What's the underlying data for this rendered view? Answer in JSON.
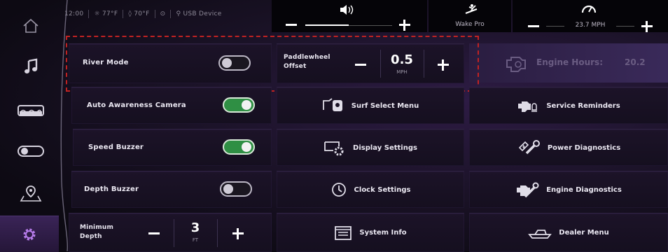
{
  "status_bar": {
    "time": "12:00",
    "outside_temp": "77°F",
    "water_temp": "70°F",
    "usb": "USB Device"
  },
  "top_controls": {
    "volume": {
      "level": 0.4
    },
    "wake_mode": "Wake Pro",
    "speed": "23.7 MPH"
  },
  "sidebar": {
    "items": [
      {
        "name": "home",
        "active": false
      },
      {
        "name": "music",
        "active": false
      },
      {
        "name": "boat",
        "active": false
      },
      {
        "name": "toggles",
        "active": false
      },
      {
        "name": "map",
        "active": false
      },
      {
        "name": "settings",
        "active": true
      }
    ]
  },
  "settings": {
    "river_mode": {
      "label": "River Mode",
      "on": false
    },
    "paddlewheel": {
      "label_line1": "Paddlewheel",
      "label_line2": "Offset",
      "value": "0.5",
      "unit": "MPH"
    },
    "engine_hours": {
      "label": "Engine Hours:",
      "value": "20.2"
    },
    "auto_awareness": {
      "label": "Auto Awareness Camera",
      "on": true
    },
    "speed_buzzer": {
      "label": "Speed Buzzer",
      "on": true
    },
    "depth_buzzer": {
      "label": "Depth Buzzer",
      "on": false
    },
    "minimum_depth": {
      "label_line1": "Minimum",
      "label_line2": "Depth",
      "value": "3",
      "unit": "FT"
    }
  },
  "menus": {
    "surf_select": "Surf Select Menu",
    "display_settings": "Display Settings",
    "clock_settings": "Clock Settings",
    "system_info": "System Info",
    "service_reminders": "Service Reminders",
    "power_diagnostics": "Power Diagnostics",
    "engine_diagnostics": "Engine Diagnostics",
    "dealer_menu": "Dealer Menu"
  },
  "colors": {
    "toggle_on": "#2f8f44",
    "highlight_dash": "#c02222",
    "accent_purple": "#3a2457"
  }
}
